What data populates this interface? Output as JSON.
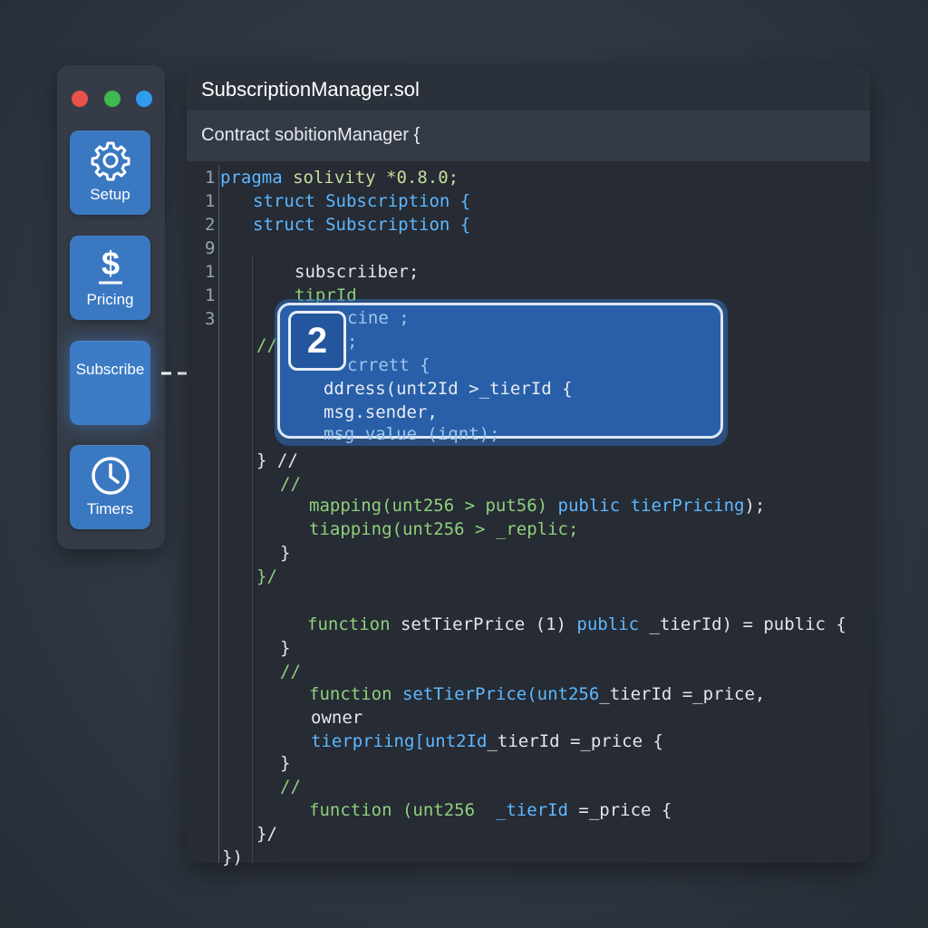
{
  "window_controls": [
    "close",
    "minimize",
    "maximize"
  ],
  "sidebar": {
    "items": [
      {
        "label": "Setup",
        "icon": "gear-icon"
      },
      {
        "label": "Pricing",
        "icon": "dollar-icon"
      },
      {
        "label": "Subscribe",
        "icon": "",
        "active": true
      },
      {
        "label": "Timers",
        "icon": "clock-icon"
      }
    ]
  },
  "editor": {
    "filename": "SubscriptionManager.sol",
    "breadcrumb": "Contract sobitionManager {",
    "gutter_numbers": [
      "1",
      "1",
      "2",
      "9",
      "1",
      "1",
      "3"
    ],
    "lines": {
      "l1": {
        "kw": "pragma",
        "rest": " solivity *0.8.0;"
      },
      "l2": {
        "kw": "struct",
        "rest": " Subscription {"
      },
      "l3": {
        "kw": "struct",
        "rest": " Subscription {"
      },
      "l4": "subscriiber;",
      "l5": "tiprId",
      "l6": "//",
      "l7": "} //",
      "l8": "//",
      "l9a": "mapping(unt256 > put56) ",
      "l9b": "public tierPricing",
      "l9c": ");",
      "l10a": "tiapping(unt256 > ",
      "l10b": "_replic;",
      "l11": "}",
      "l12": "}/",
      "l13a": "function",
      "l13b": " setTierPrice (1) ",
      "l13c": "public",
      "l13d": " _tierId) = public {",
      "l14": "}",
      "l15": "//",
      "l16a": "function",
      "l16b": " setTierPrice(unt256",
      "l16c": "_tierId =_price,",
      "l17": "owner",
      "l18a": "tierpriing[unt2Id",
      "l18b": "_tierId =_price {",
      "l19": "}",
      "l20": "//",
      "l21a": "function",
      "l21b": " (unt256  ",
      "l21c": "_tierId",
      "l21d": " =_price {",
      "l22": "}/",
      "l23": "})"
    }
  },
  "highlight": {
    "step": "2",
    "lines": [
      "cine ;",
      ";",
      "crrett {",
      "ddress(unt2Id >_tierId {",
      "msg.sender,",
      "msg value (iqnt);"
    ]
  },
  "colors": {
    "accent_blue": "#3a78c2",
    "keyword": "#5fb8ff",
    "function": "#8fd07c",
    "dot_red": "#e5534b",
    "dot_green": "#3fb950",
    "dot_blue": "#2f9cf0"
  }
}
